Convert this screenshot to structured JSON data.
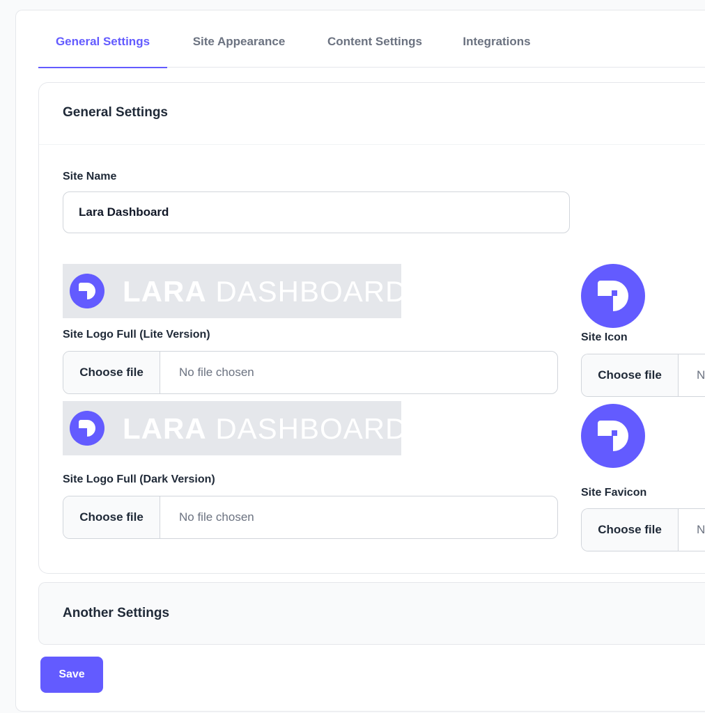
{
  "tabs": [
    {
      "label": "General Settings",
      "active": true
    },
    {
      "label": "Site Appearance",
      "active": false
    },
    {
      "label": "Content Settings",
      "active": false
    },
    {
      "label": "Integrations",
      "active": false
    }
  ],
  "general": {
    "title": "General Settings",
    "site_name_label": "Site Name",
    "site_name_value": "Lara Dashboard",
    "logo_lite_label": "Site Logo Full (Lite Version)",
    "logo_dark_label": "Site Logo Full (Dark Version)",
    "site_icon_label": "Site Icon",
    "site_favicon_label": "Site Favicon",
    "choose_file_label": "Choose file",
    "no_file_label": "No file chosen",
    "no_file_truncated": "N",
    "logo_word_bold": "LARA",
    "logo_word_light": "DASHBOARD"
  },
  "another": {
    "title": "Another Settings"
  },
  "actions": {
    "save_label": "Save"
  },
  "colors": {
    "accent": "#635bff",
    "border": "#e5e7eb",
    "muted_text": "#6b7280"
  }
}
